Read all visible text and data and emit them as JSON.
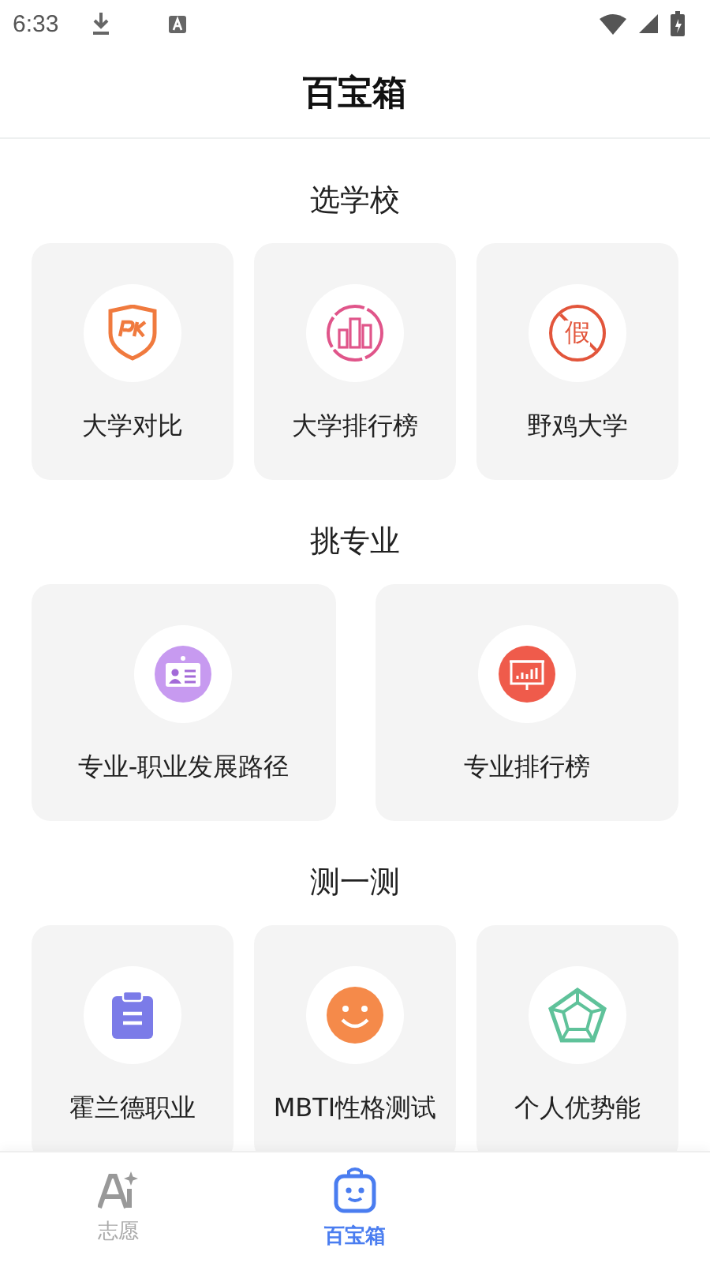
{
  "status_bar": {
    "time": "6:33"
  },
  "header": {
    "title": "百宝箱"
  },
  "sections": [
    {
      "title": "选学校",
      "items": [
        {
          "label": "大学对比",
          "kind": "pk"
        },
        {
          "label": "大学排行榜",
          "kind": "bars"
        },
        {
          "label": "野鸡大学",
          "kind": "fake",
          "icon_text": "假"
        }
      ]
    },
    {
      "title": "挑专业",
      "items": [
        {
          "label": "专业-职业发展路径",
          "kind": "card"
        },
        {
          "label": "专业排行榜",
          "kind": "board"
        }
      ]
    },
    {
      "title": "测一测",
      "items": [
        {
          "label": "霍兰德职业",
          "kind": "clipboard"
        },
        {
          "label": "MBTI性格测试",
          "kind": "smile"
        },
        {
          "label": "个人优势能",
          "kind": "pentagon"
        }
      ]
    }
  ],
  "tabs": [
    {
      "label": "志愿",
      "kind": "ai",
      "selected": false
    },
    {
      "label": "百宝箱",
      "kind": "robot",
      "selected": true
    }
  ]
}
